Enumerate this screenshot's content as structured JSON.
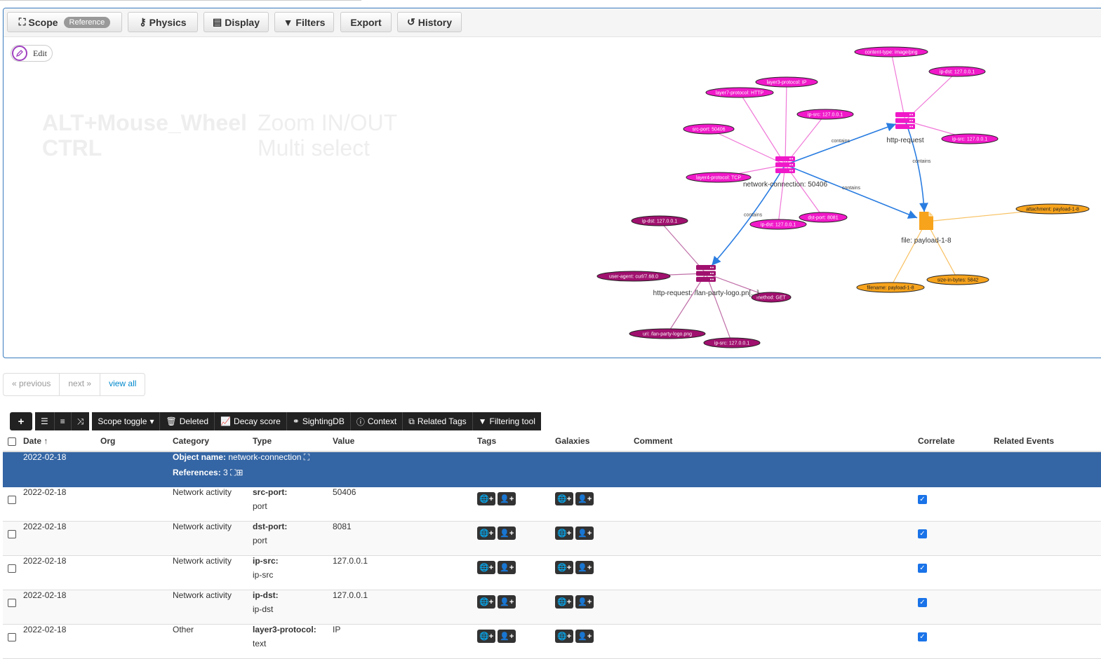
{
  "toolbar": {
    "scope_label": "Scope",
    "scope_badge": "Reference",
    "physics_label": "Physics",
    "display_label": "Display",
    "filters_label": "Filters",
    "export_label": "Export",
    "history_label": "History"
  },
  "edit_label": "Edit",
  "hints": [
    {
      "key": "ALT+Mouse_Wheel",
      "action": "Zoom IN/OUT"
    },
    {
      "key": "CTRL",
      "action": "Multi select"
    }
  ],
  "graph": {
    "nodes": [
      {
        "id": "nc",
        "label": "network-connection: 50406",
        "kind": "object",
        "color": "#f018c8"
      },
      {
        "id": "hr",
        "label": "http-request",
        "kind": "object",
        "color": "#f018c8"
      },
      {
        "id": "hr2",
        "label": "http-request: /lan-party-logo.pn[...]",
        "kind": "object",
        "color": "#a0106e"
      },
      {
        "id": "file",
        "label": "file: payload-1-8",
        "kind": "file",
        "color": "#f7a31c"
      }
    ],
    "pills": [
      {
        "text": "layer3-protocol: IP",
        "parent": "nc",
        "group": "pink"
      },
      {
        "text": "layer7-protocol: HTTP",
        "parent": "nc",
        "group": "pink"
      },
      {
        "text": "src-port: 50406",
        "parent": "nc",
        "group": "pink"
      },
      {
        "text": "ip-src: 127.0.0.1",
        "parent": "nc",
        "group": "pink"
      },
      {
        "text": "layer4-protocol: TCP",
        "parent": "nc",
        "group": "pink"
      },
      {
        "text": "ip-dst: 127.0.0.1",
        "parent": "nc",
        "group": "pink"
      },
      {
        "text": "dst-port: 8081",
        "parent": "nc",
        "group": "pink"
      },
      {
        "text": "content-type: image/png",
        "parent": "hr",
        "group": "pink"
      },
      {
        "text": "ip-dst: 127.0.0.1",
        "parent": "hr",
        "group": "pink"
      },
      {
        "text": "ip-src: 127.0.0.1",
        "parent": "hr",
        "group": "pink"
      },
      {
        "text": "ip-dst: 127.0.0.1",
        "parent": "hr2",
        "group": "dark"
      },
      {
        "text": "user-agent: curl/7.68.0",
        "parent": "hr2",
        "group": "dark"
      },
      {
        "text": "method: GET",
        "parent": "hr2",
        "group": "dark"
      },
      {
        "text": "uri: /lan-party-logo.png",
        "parent": "hr2",
        "group": "dark"
      },
      {
        "text": "ip-src: 127.0.0.1",
        "parent": "hr2",
        "group": "dark"
      },
      {
        "text": "attachment: payload-1-8",
        "parent": "file",
        "group": "orange"
      },
      {
        "text": "filename: payload-1-8",
        "parent": "file",
        "group": "orange"
      },
      {
        "text": "size-in-bytes: 5842",
        "parent": "file",
        "group": "orange"
      }
    ],
    "edges": [
      {
        "from": "nc",
        "to": "hr",
        "label": "contains"
      },
      {
        "from": "hr",
        "to": "file",
        "label": "contains"
      },
      {
        "from": "nc",
        "to": "file",
        "label": "contains"
      },
      {
        "from": "nc",
        "to": "hr2",
        "label": "contains"
      }
    ]
  },
  "pager": {
    "previous": "« previous",
    "next": "next »",
    "view_all": "view all"
  },
  "actions": {
    "add": "+",
    "scope_toggle": "Scope toggle",
    "deleted": "Deleted",
    "decay_score": "Decay score",
    "sightingdb": "SightingDB",
    "context": "Context",
    "related_tags": "Related Tags",
    "filtering_tool": "Filtering tool"
  },
  "columns": {
    "date": "Date ↑",
    "org": "Org",
    "category": "Category",
    "type": "Type",
    "value": "Value",
    "tags": "Tags",
    "galaxies": "Galaxies",
    "comment": "Comment",
    "correlate": "Correlate",
    "related_events": "Related Events"
  },
  "object_row": {
    "date": "2022-02-18",
    "name_label": "Object name:",
    "name_value": "network-connection",
    "refs_label": "References:",
    "refs_value": "3"
  },
  "rows": [
    {
      "date": "2022-02-18",
      "category": "Network activity",
      "type": "src-port:",
      "subtype": "port",
      "value": "50406"
    },
    {
      "date": "2022-02-18",
      "category": "Network activity",
      "type": "dst-port:",
      "subtype": "port",
      "value": "8081"
    },
    {
      "date": "2022-02-18",
      "category": "Network activity",
      "type": "ip-src:",
      "subtype": "ip-src",
      "value": "127.0.0.1"
    },
    {
      "date": "2022-02-18",
      "category": "Network activity",
      "type": "ip-dst:",
      "subtype": "ip-dst",
      "value": "127.0.0.1"
    },
    {
      "date": "2022-02-18",
      "category": "Other",
      "type": "layer3-protocol:",
      "subtype": "text",
      "value": "IP"
    }
  ]
}
